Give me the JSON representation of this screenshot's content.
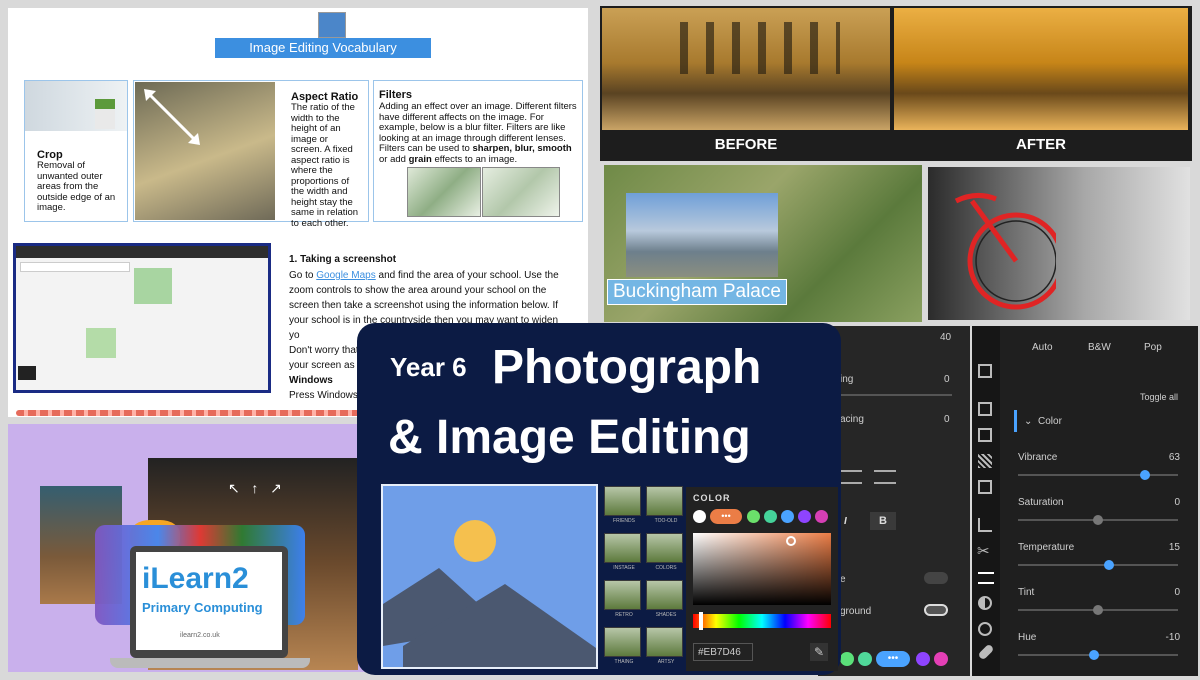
{
  "vocab": {
    "title": "Image Editing Vocabulary",
    "crop": {
      "heading": "Crop",
      "text": "Removal of unwanted outer areas from the outside edge of an image."
    },
    "aspect": {
      "heading": "Aspect Ratio",
      "text": "The ratio of the width to the height of an image or screen. A fixed aspect ratio is where the proportions of the width and height stay the same in relation to each other."
    },
    "filters": {
      "heading": "Filters",
      "text_pre": "Adding an effect over an image. Different filters have different affects on the image. For example, below is a blur filter. Filters are like looking at an image through different lenses. Filters can be used to ",
      "bold1": "sharpen, blur, smooth",
      "text_mid": " or add ",
      "bold2": "grain",
      "text_post": " effects to an image."
    }
  },
  "screenshot": {
    "heading": "1. Taking a screenshot",
    "para_pre": "Go to ",
    "link": "Google Maps",
    "para_post": " and find the area of your school. Use the zoom controls to show the area around your school on the screen then take a screenshot using the information below. If your school is in the countryside then you may want to widen yo",
    "line2": "Don't worry that",
    "line3": "your screen as w",
    "windows": "Windows",
    "press": "Press Windows"
  },
  "beforeafter": {
    "before": "BEFORE",
    "after": "AFTER"
  },
  "map": {
    "label": "Buckingham Palace"
  },
  "ilearn": {
    "brand": "iLearn2",
    "sub": "Primary Computing",
    "url": "ilearn2.co.uk"
  },
  "main": {
    "year": "Year 6",
    "title_line1": "Photograph",
    "title_line2": "& Image Editing"
  },
  "filters_grid": [
    "FRIENDS",
    "TOO-OLD",
    "INSTAGE",
    "COLORS",
    "RETRO",
    "SHADES",
    "THAING",
    "ARTSY"
  ],
  "colorpicker": {
    "label": "COLOR",
    "hex": "#EB7D46",
    "dots": "•••"
  },
  "midpanel": {
    "v1": "40",
    "l1": "ing",
    "v2": "0",
    "l2": "acing",
    "v3": "0",
    "l3": "e",
    "l4": "ground",
    "dots": "•••",
    "i": "I",
    "b": "B"
  },
  "rightpanel": {
    "presets": [
      "Auto",
      "B&W",
      "Pop"
    ],
    "toggle_all": "Toggle all",
    "section": "Color",
    "sliders": [
      {
        "label": "Vibrance",
        "value": 63
      },
      {
        "label": "Saturation",
        "value": 0
      },
      {
        "label": "Temperature",
        "value": 15
      },
      {
        "label": "Tint",
        "value": 0
      },
      {
        "label": "Hue",
        "value": -10
      }
    ]
  },
  "colors": {
    "accent": "#3c8fe0",
    "navy": "#0c1b44",
    "orange": "#EB7D46",
    "sun": "#f5c04e",
    "mountain": "#4b5870"
  }
}
